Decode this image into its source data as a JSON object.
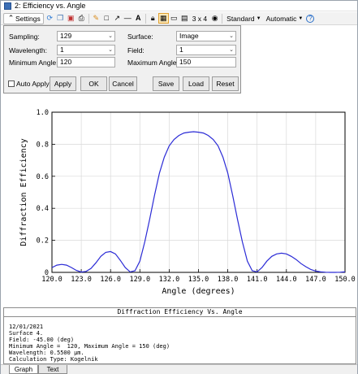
{
  "window": {
    "title": "2: Efficiency vs. Angle"
  },
  "toolbar": {
    "settings_label": "Settings",
    "layout_label": "3 x 4",
    "standard_label": "Standard",
    "automatic_label": "Automatic"
  },
  "settings": {
    "sampling_label": "Sampling:",
    "sampling_value": "129",
    "wavelength_label": "Wavelength:",
    "wavelength_value": "1",
    "min_angle_label": "Minimum Angle:",
    "min_angle_value": "120",
    "surface_label": "Surface:",
    "surface_value": "Image",
    "field_label": "Field:",
    "field_value": "1",
    "max_angle_label": "Maximum Angle:",
    "max_angle_value": "150",
    "auto_apply_label": "Auto Apply",
    "apply_label": "Apply",
    "ok_label": "OK",
    "cancel_label": "Cancel",
    "save_label": "Save",
    "load_label": "Load",
    "reset_label": "Reset"
  },
  "chart_data": {
    "type": "line",
    "xlabel": "Angle (degrees)",
    "ylabel": "Diffraction Efficiency",
    "xlim": [
      120.0,
      150.0
    ],
    "ylim": [
      0,
      1.0
    ],
    "x_ticks": [
      "120.0",
      "123.0",
      "126.0",
      "129.0",
      "132.0",
      "135.0",
      "138.0",
      "141.0",
      "144.0",
      "147.0",
      "150.0"
    ],
    "y_ticks": [
      "0",
      "0.2",
      "0.4",
      "0.6",
      "0.8",
      "1.0"
    ],
    "grid": true,
    "line_color": "#2b2bd6",
    "series": [
      {
        "x": [
          120.0,
          120.5,
          121.0,
          121.5,
          122.0,
          122.5,
          123.0,
          123.5,
          124.0,
          124.5,
          125.0,
          125.5,
          126.0,
          126.5,
          127.0,
          127.5,
          128.0,
          128.5,
          129.0,
          129.5,
          130.0,
          130.5,
          131.0,
          131.5,
          132.0,
          132.5,
          133.0,
          133.5,
          134.0,
          134.5,
          135.0,
          135.5,
          136.0,
          136.5,
          137.0,
          137.5,
          138.0,
          138.5,
          139.0,
          139.5,
          140.0,
          140.5,
          141.0,
          141.5,
          142.0,
          142.5,
          143.0,
          143.5,
          144.0,
          144.5,
          145.0,
          145.5,
          146.0,
          146.5,
          147.0,
          147.5,
          148.0,
          148.5,
          149.0,
          149.5,
          150.0
        ],
        "y": [
          0.03,
          0.045,
          0.05,
          0.045,
          0.03,
          0.012,
          0.002,
          0.006,
          0.025,
          0.06,
          0.1,
          0.125,
          0.13,
          0.115,
          0.075,
          0.03,
          0.003,
          0.01,
          0.07,
          0.19,
          0.33,
          0.48,
          0.62,
          0.72,
          0.79,
          0.83,
          0.855,
          0.87,
          0.875,
          0.878,
          0.875,
          0.87,
          0.855,
          0.83,
          0.79,
          0.72,
          0.62,
          0.48,
          0.33,
          0.19,
          0.07,
          0.01,
          0.003,
          0.03,
          0.07,
          0.1,
          0.115,
          0.12,
          0.115,
          0.1,
          0.08,
          0.055,
          0.035,
          0.018,
          0.008,
          0.003,
          0.001,
          0.0,
          0.0,
          0.001,
          0.003
        ]
      }
    ]
  },
  "report": {
    "title": "Diffraction Efficiency Vs. Angle",
    "lines": [
      "12/01/2021",
      "Surface 4.",
      "Field: -45.00 (deg)",
      "Minimum Angle =  120, Maximum Angle = 150 (deg)",
      "Wavelength: 0.5500 µm.",
      "Calculation Type: Kogelnik"
    ]
  },
  "tabs": {
    "graph_label": "Graph",
    "text_label": "Text"
  }
}
